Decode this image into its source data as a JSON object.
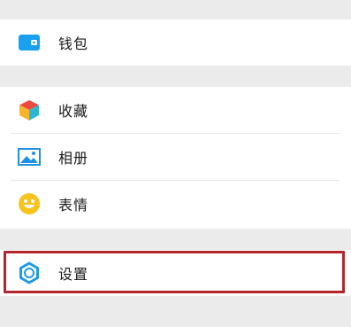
{
  "menu": {
    "wallet": {
      "label": "钱包",
      "icon": "wallet-icon"
    },
    "favorites": {
      "label": "收藏",
      "icon": "cube-icon"
    },
    "album": {
      "label": "相册",
      "icon": "image-icon"
    },
    "stickers": {
      "label": "表情",
      "icon": "smiley-icon"
    },
    "settings": {
      "label": "设置",
      "icon": "gear-icon"
    }
  },
  "colors": {
    "background": "#ebebeb",
    "row_bg": "#ffffff",
    "wallet_blue": "#1aa0f0",
    "cube_red": "#ea4b3c",
    "cube_yellow": "#f7b52b",
    "cube_teal": "#2fb6d4",
    "image_blue": "#1e90e6",
    "smiley_yellow": "#f7c41f",
    "gear_blue": "#1e9be8",
    "highlight": "#b4262c"
  }
}
